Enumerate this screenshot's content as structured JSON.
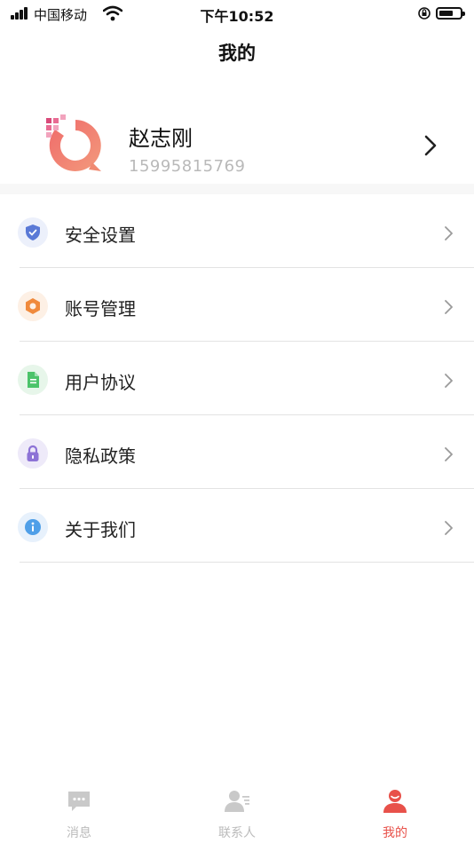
{
  "status_bar": {
    "carrier": "中国移动",
    "time": "下午10:52",
    "battery_level": 0.7
  },
  "header": {
    "title": "我的"
  },
  "profile": {
    "name": "赵志刚",
    "phone": "15995815769"
  },
  "menu": [
    {
      "label": "安全设置",
      "icon": "shield-icon",
      "color": "#5a79d6",
      "bg": "#ecf0fb"
    },
    {
      "label": "账号管理",
      "icon": "account-icon",
      "color": "#f08a3c",
      "bg": "#fdf0e5"
    },
    {
      "label": "用户协议",
      "icon": "document-icon",
      "color": "#4cc36a",
      "bg": "#e7f6ea"
    },
    {
      "label": "隐私政策",
      "icon": "lock-icon",
      "color": "#8d73d6",
      "bg": "#eeeaf9"
    },
    {
      "label": "关于我们",
      "icon": "info-icon",
      "color": "#4f9fe8",
      "bg": "#e7f1fc"
    }
  ],
  "tabs": [
    {
      "label": "消息",
      "icon": "message-icon",
      "active": false
    },
    {
      "label": "联系人",
      "icon": "contacts-icon",
      "active": false
    },
    {
      "label": "我的",
      "icon": "profile-icon",
      "active": true
    }
  ],
  "colors": {
    "accent": "#e8514a",
    "inactive": "#bbbbbb"
  }
}
